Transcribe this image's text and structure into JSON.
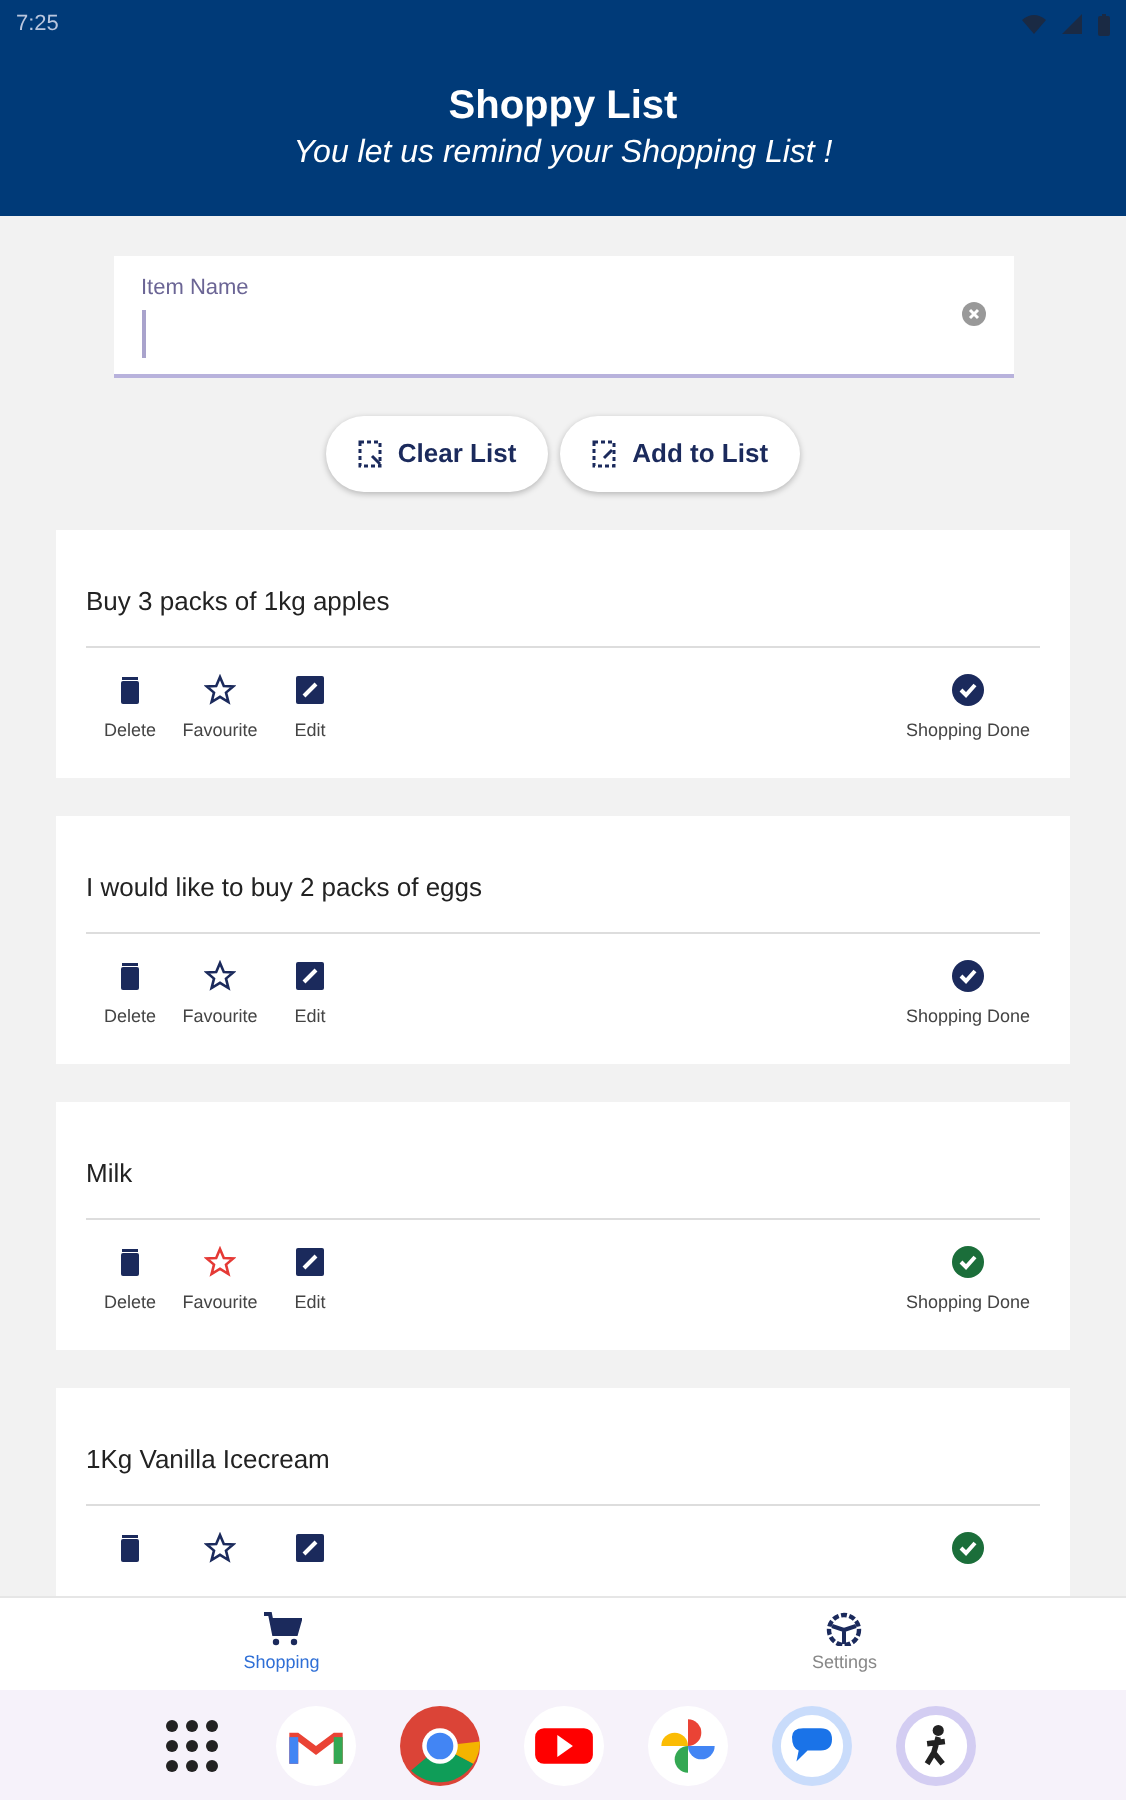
{
  "status_bar": {
    "time": "7:25"
  },
  "header": {
    "title": "Shoppy List",
    "subtitle": "You let us remind your Shopping List !"
  },
  "item_field": {
    "label": "Item Name",
    "focused": true
  },
  "buttons": [
    {
      "kind": "clear",
      "label": "Clear List"
    },
    {
      "kind": "add",
      "label": "Add to List"
    }
  ],
  "items": [
    {
      "text": "Buy 3 packs of 1kg apples",
      "favourite": false,
      "done": false,
      "labels": {
        "delete": "Delete",
        "favourite": "Favourite",
        "edit": "Edit",
        "done": "Shopping Done"
      }
    },
    {
      "text": "I would like to buy 2 packs of eggs",
      "favourite": false,
      "done": false,
      "labels": {
        "delete": "Delete",
        "favourite": "Favourite",
        "edit": "Edit",
        "done": "Shopping Done"
      }
    },
    {
      "text": "Milk",
      "favourite": true,
      "done": true,
      "labels": {
        "delete": "Delete",
        "favourite": "Favourite",
        "edit": "Edit",
        "done": "Shopping Done"
      }
    },
    {
      "text": "1Kg Vanilla Icecream",
      "favourite": false,
      "done": true
    }
  ],
  "bottom_nav": [
    {
      "kind": "shopping",
      "label": "Shopping",
      "selected": true
    },
    {
      "kind": "settings",
      "label": "Settings",
      "selected": false
    }
  ],
  "dock": [
    {
      "kind": "apps"
    },
    {
      "kind": "mail"
    },
    {
      "kind": "browser"
    },
    {
      "kind": "video"
    },
    {
      "kind": "photos"
    },
    {
      "kind": "messages"
    },
    {
      "kind": "figure"
    }
  ]
}
